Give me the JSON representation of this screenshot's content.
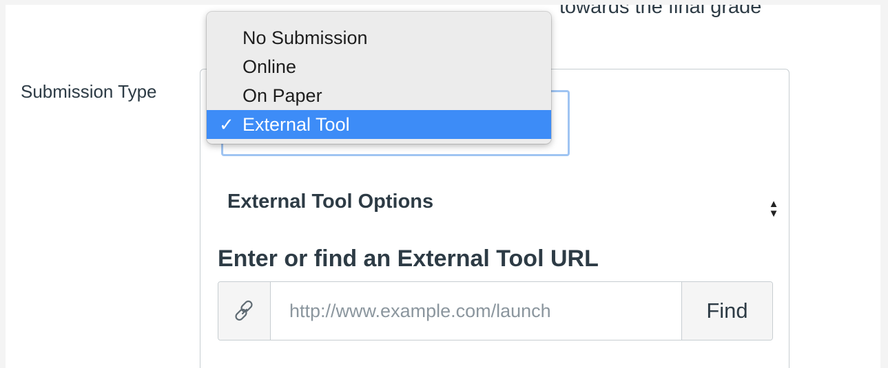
{
  "page_header": {
    "truncated_text": "towards the final grade"
  },
  "submission_type": {
    "label": "Submission Type",
    "selected_option": "External Tool",
    "options": [
      {
        "label": "No Submission",
        "selected": false
      },
      {
        "label": "Online",
        "selected": false
      },
      {
        "label": "On Paper",
        "selected": false
      },
      {
        "label": "External Tool",
        "selected": true,
        "checkmark": "✓"
      }
    ]
  },
  "external_tool": {
    "section_title": "External Tool Options",
    "url_title": "Enter or find an External Tool URL",
    "url_input": {
      "value": "",
      "placeholder": "http://www.example.com/launch"
    },
    "find_button_label": "Find",
    "link_icon": "link-icon"
  },
  "colors": {
    "selected_highlight": "#3d8cf7",
    "focus_border": "#9fc4f2",
    "text": "#2d3b45",
    "placeholder": "#8b969e",
    "border": "#c7cdd1"
  }
}
